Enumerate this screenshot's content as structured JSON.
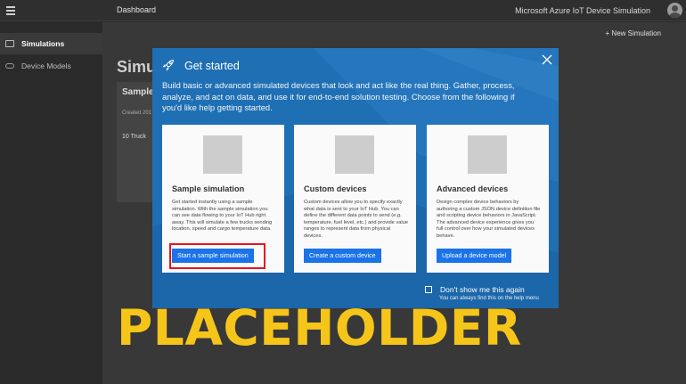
{
  "topbar": {
    "breadcrumb": "Dashboard",
    "app_title": "Microsoft Azure IoT Device Simulation"
  },
  "sidebar": {
    "items": [
      {
        "label": "Simulations",
        "icon": "simulations-icon",
        "active": true
      },
      {
        "label": "Device Models",
        "icon": "device-models-icon",
        "active": false
      }
    ]
  },
  "main": {
    "new_simulation": "+ New Simulation",
    "page_title": "Simu",
    "sim_card": {
      "title": "Sample",
      "created": "Created 201",
      "devices": "10 Truck"
    }
  },
  "modal": {
    "title": "Get started",
    "intro": "Build basic or advanced simulated devices that look and act like the real thing. Gather, process, analyze, and act on data, and use it for end-to-end solution testing. Choose from the following if you'd like help getting started.",
    "cards": [
      {
        "title": "Sample simulation",
        "description": "Get started instantly using a sample simulation. With the sample simulation you can see data flowing to your IoT Hub right away. This will simulate a few trucks sending location, speed and cargo temperature data.",
        "button": "Start a sample simulation"
      },
      {
        "title": "Custom devices",
        "description": "Custom devices allow you to specify exactly what data is sent to your IoT Hub. You can define the different data points to send (e.g. temperature, fuel level, etc.) and provide value ranges to represent data from physical devices.",
        "button": "Create a custom device"
      },
      {
        "title": "Advanced devices",
        "description": "Design complex device behaviors by authoring a custom JSON device definition file and scripting device behaviors in JavaScript. The advanced device experience gives you full control over how your simulated devices behave.",
        "button": "Upload a device model"
      }
    ],
    "dont_show": "Don't show me this again",
    "help_note": "You can always find this on the help menu"
  },
  "overlay": {
    "text": "PLACEHOLDER",
    "color": "#f6c51a"
  },
  "colors": {
    "modal_bg": "#1f6fb4",
    "button": "#1a73e8",
    "highlight": "#e5141d"
  }
}
